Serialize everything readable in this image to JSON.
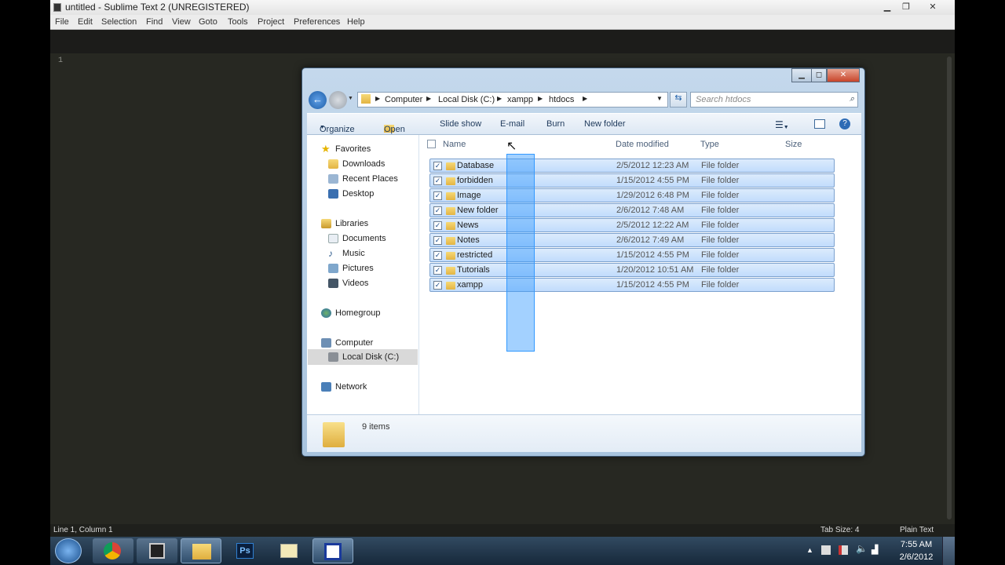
{
  "sublime": {
    "title": "untitled - Sublime Text 2 (UNREGISTERED)",
    "menu": [
      "File",
      "Edit",
      "Selection",
      "Find",
      "View",
      "Goto",
      "Tools",
      "Project",
      "Preferences",
      "Help"
    ],
    "gutter_line": "1",
    "status_left": "Line 1, Column 1",
    "status_tab": "Tab Size: 4",
    "status_syntax": "Plain Text"
  },
  "explorer": {
    "breadcrumb": [
      "Computer",
      "Local Disk (C:)",
      "xampp",
      "htdocs"
    ],
    "search_placeholder": "Search htdocs",
    "toolbar": {
      "organize": "Organize",
      "open": "Open",
      "slideshow": "Slide show",
      "email": "E-mail",
      "burn": "Burn",
      "new_folder": "New folder"
    },
    "nav": {
      "favorites": "Favorites",
      "downloads": "Downloads",
      "recent": "Recent Places",
      "desktop": "Desktop",
      "libraries": "Libraries",
      "documents": "Documents",
      "music": "Music",
      "pictures": "Pictures",
      "videos": "Videos",
      "homegroup": "Homegroup",
      "computer": "Computer",
      "localdisk": "Local Disk (C:)",
      "network": "Network"
    },
    "columns": {
      "name": "Name",
      "date": "Date modified",
      "type": "Type",
      "size": "Size"
    },
    "rows": [
      {
        "name": "Database",
        "date": "2/5/2012 12:23 AM",
        "type": "File folder"
      },
      {
        "name": "forbidden",
        "date": "1/15/2012 4:55 PM",
        "type": "File folder"
      },
      {
        "name": "Image",
        "date": "1/29/2012 6:48 PM",
        "type": "File folder"
      },
      {
        "name": "New folder",
        "date": "2/6/2012 7:48 AM",
        "type": "File folder"
      },
      {
        "name": "News",
        "date": "2/5/2012 12:22 AM",
        "type": "File folder"
      },
      {
        "name": "Notes",
        "date": "2/6/2012 7:49 AM",
        "type": "File folder"
      },
      {
        "name": "restricted",
        "date": "1/15/2012 4:55 PM",
        "type": "File folder"
      },
      {
        "name": "Tutorials",
        "date": "1/20/2012 10:51 AM",
        "type": "File folder"
      },
      {
        "name": "xampp",
        "date": "1/15/2012 4:55 PM",
        "type": "File folder"
      }
    ],
    "details": "9 items"
  },
  "taskbar": {
    "time": "7:55 AM",
    "date": "2/6/2012",
    "ps_label": "Ps"
  }
}
